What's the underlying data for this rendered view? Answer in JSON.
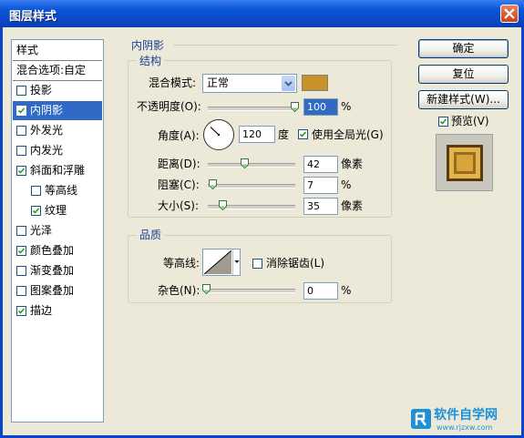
{
  "window": {
    "title": "图层样式"
  },
  "style_list": {
    "header": "样式",
    "blend_options": "混合选项:自定",
    "items": [
      {
        "label": "投影",
        "checked": false,
        "indent": false,
        "selected": false
      },
      {
        "label": "内阴影",
        "checked": true,
        "indent": false,
        "selected": true
      },
      {
        "label": "外发光",
        "checked": false,
        "indent": false,
        "selected": false
      },
      {
        "label": "内发光",
        "checked": false,
        "indent": false,
        "selected": false
      },
      {
        "label": "斜面和浮雕",
        "checked": true,
        "indent": false,
        "selected": false
      },
      {
        "label": "等高线",
        "checked": false,
        "indent": true,
        "selected": false
      },
      {
        "label": "纹理",
        "checked": true,
        "indent": true,
        "selected": false
      },
      {
        "label": "光泽",
        "checked": false,
        "indent": false,
        "selected": false
      },
      {
        "label": "颜色叠加",
        "checked": true,
        "indent": false,
        "selected": false
      },
      {
        "label": "渐变叠加",
        "checked": false,
        "indent": false,
        "selected": false
      },
      {
        "label": "图案叠加",
        "checked": false,
        "indent": false,
        "selected": false
      },
      {
        "label": "描边",
        "checked": true,
        "indent": false,
        "selected": false
      }
    ]
  },
  "inner_shadow": {
    "section_title": "内阴影",
    "structure": {
      "title": "结构",
      "blend_mode_label": "混合模式:",
      "blend_mode_value": "正常",
      "blend_color": "#c8922a",
      "opacity_label": "不透明度(O):",
      "opacity_value": "100",
      "opacity_percent": 1.0,
      "percent_unit": "%",
      "angle_label": "角度(A):",
      "angle_value": "120",
      "angle_unit": "度",
      "global_light_label": "使用全局光(G)",
      "global_light_checked": true,
      "distance_label": "距离(D):",
      "distance_value": "42",
      "distance_unit": "像素",
      "choke_label": "阻塞(C):",
      "choke_value": "7",
      "choke_unit": "%",
      "size_label": "大小(S):",
      "size_value": "35",
      "size_unit": "像素"
    },
    "quality": {
      "title": "品质",
      "contour_label": "等高线:",
      "antialias_label": "消除锯齿(L)",
      "antialias_checked": false,
      "noise_label": "杂色(N):",
      "noise_value": "0",
      "noise_unit": "%"
    }
  },
  "buttons": {
    "ok": "确定",
    "reset": "复位",
    "new_style": "新建样式(W)...",
    "preview_label": "预览(V)",
    "preview_checked": true
  },
  "colors": {
    "accent": "#316ac5",
    "title_blue": "#0a56d8",
    "group_title": "#1c3f94"
  },
  "watermark": {
    "brand": "软件自学网",
    "url": "www.rjzxw.com"
  }
}
